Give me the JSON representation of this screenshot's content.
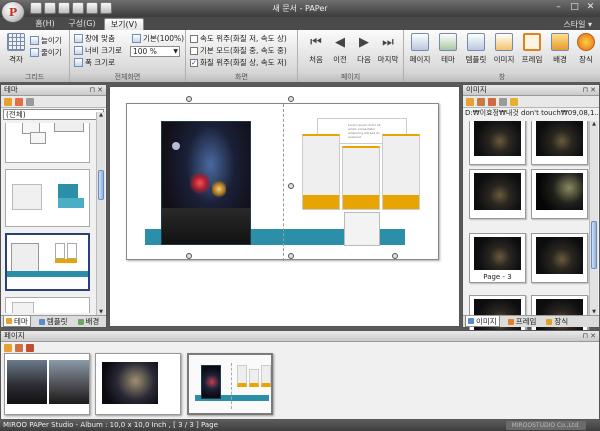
{
  "window": {
    "title": "새 문서 - PAPer",
    "minimize": "–",
    "maximize": "□",
    "close": "✕"
  },
  "ribbon_tabs": [
    {
      "label": "홈(H)"
    },
    {
      "label": "구성(G)"
    },
    {
      "label": "보기(V)"
    }
  ],
  "style_menu": "스타일 ▾",
  "groups": {
    "grid": {
      "label": "그리드",
      "grid_button": "격자",
      "zoom_in": "늘이기",
      "zoom_out": "줄이기"
    },
    "fullview": {
      "label": "전체화면",
      "fit_screen": "창에 맞춤",
      "fit_width": "너비 크기로",
      "fit_width2": "폭 크기로",
      "default_zoom": "기본(100%)",
      "zoom_value": "100 %"
    },
    "screen": {
      "label": "화면",
      "opt1": "속도 위주(화질 저, 속도 상)",
      "opt2": "기본 모드(화질 중, 속도 중)",
      "opt3": "화질 위주(화질 상, 속도 저)"
    },
    "page_nav": {
      "label": "페이지",
      "first": "처음",
      "prev": "이전",
      "next": "다음",
      "last": "마지막"
    },
    "window_group": {
      "label": "창",
      "pages": "페이지",
      "theme": "테마",
      "templates": "템플릿",
      "images": "이미지",
      "frames": "프레임",
      "background": "배경",
      "decor": "장식"
    }
  },
  "theme_panel": {
    "title": "테마",
    "filter": "(전체)",
    "tabs": [
      {
        "label": "테마"
      },
      {
        "label": "템플릿"
      },
      {
        "label": "배경"
      }
    ]
  },
  "image_panel": {
    "title": "이미지",
    "path": "D:₩이효정₩내것 don't touch₩09,08,1...",
    "items": [
      {
        "caption": ""
      },
      {
        "caption": ""
      },
      {
        "caption": ""
      },
      {
        "caption": ""
      },
      {
        "caption": "Page - 3"
      },
      {
        "caption": ""
      },
      {
        "caption": ""
      },
      {
        "caption": ""
      }
    ],
    "tabs": [
      {
        "label": "이미지"
      },
      {
        "label": "프레임"
      },
      {
        "label": "장식"
      }
    ]
  },
  "pages_panel": {
    "title": "페이지"
  },
  "canvas": {
    "placeholder_text": "Lorem ipsum dolor sit amet, consectetur adipiscing elit sed do eiusmod"
  },
  "status": {
    "text": "MIROO PAPer Studio - Album : 10,0 x 10,0 Inch , [ 3 / 3 ] Page",
    "brand": "MIROOSTUDIO Co.,Ltd."
  },
  "colors": {
    "accent_orange": "#e8a400",
    "accent_teal": "#2b8fa8",
    "selection": "#2b3f7a"
  }
}
